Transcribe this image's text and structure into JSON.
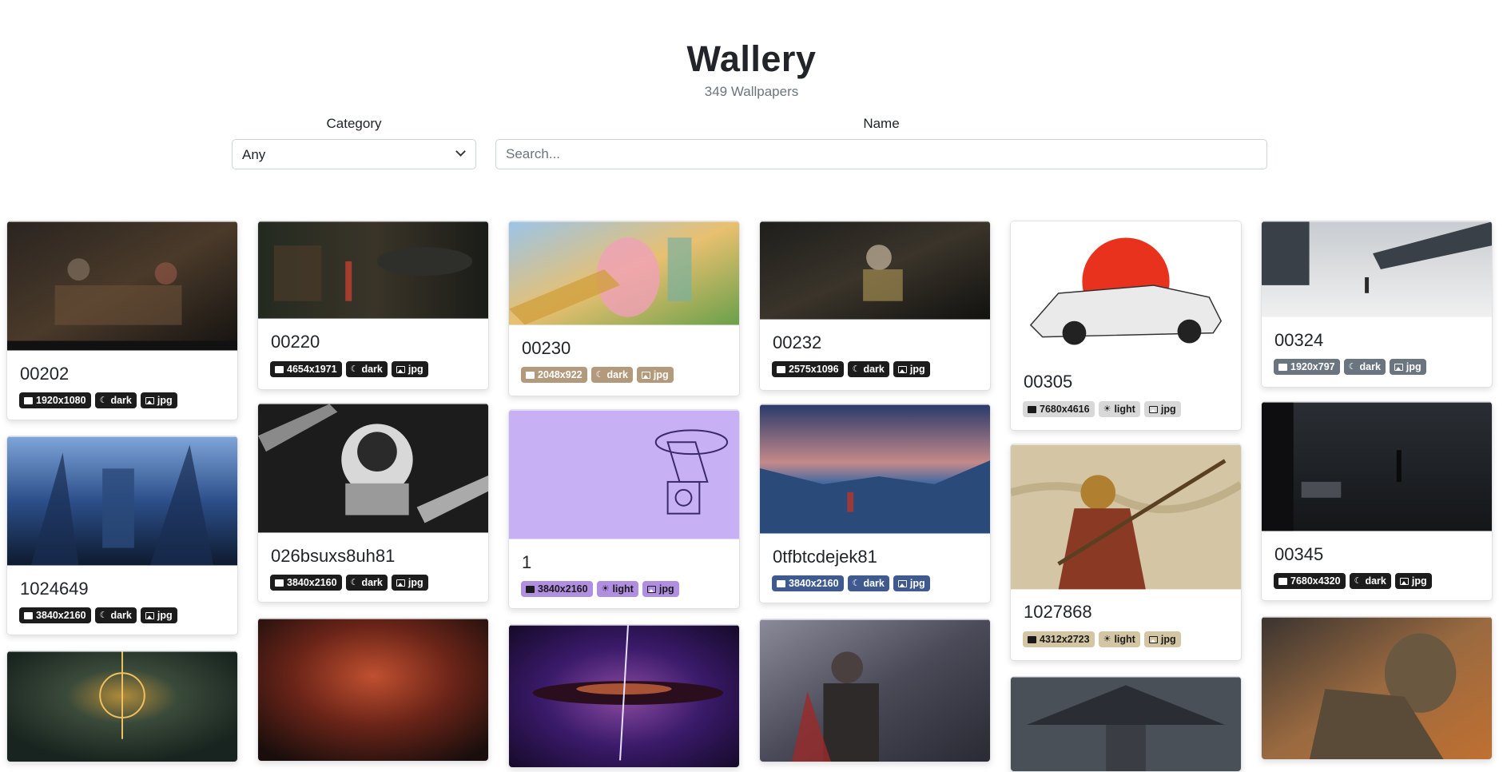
{
  "app": {
    "title": "Wallery",
    "subtitle": "349 Wallpapers"
  },
  "filters": {
    "category_label": "Category",
    "category_value": "Any",
    "name_label": "Name",
    "search_placeholder": "Search..."
  },
  "cards": [
    {
      "name": "00202",
      "resolution": "1920x1080",
      "theme": "dark",
      "format": "jpg",
      "color": "#1f1f1f"
    },
    {
      "name": "1024649",
      "resolution": "3840x2160",
      "theme": "dark",
      "format": "jpg",
      "color": "#1f2a3a"
    },
    {
      "name": "00220",
      "resolution": "4654x1971",
      "theme": "dark",
      "format": "jpg",
      "color": "#222222"
    },
    {
      "name": "026bsuxs8uh81",
      "resolution": "3840x2160",
      "theme": "dark",
      "format": "jpg",
      "color": "#1a1a1a"
    },
    {
      "name": "00230",
      "resolution": "2048x922",
      "theme": "dark",
      "format": "jpg",
      "color": "#b49a7c"
    },
    {
      "name": "1",
      "resolution": "3840x2160",
      "theme": "light",
      "format": "jpg",
      "color": "#b08ee0"
    },
    {
      "name": "00232",
      "resolution": "2575x1096",
      "theme": "dark",
      "format": "jpg",
      "color": "#1e1e1e"
    },
    {
      "name": "0tfbtcdejek81",
      "resolution": "3840x2160",
      "theme": "dark",
      "format": "jpg",
      "color": "#3f5a8f"
    },
    {
      "name": "00305",
      "resolution": "7680x4616",
      "theme": "light",
      "format": "jpg",
      "color": "#d8d8d8"
    },
    {
      "name": "1027868",
      "resolution": "4312x2723",
      "theme": "light",
      "format": "jpg",
      "color": "#d4c6a4"
    },
    {
      "name": "00324",
      "resolution": "1920x797",
      "theme": "dark",
      "format": "jpg",
      "color": "#6b7580"
    },
    {
      "name": "00345",
      "resolution": "7680x4320",
      "theme": "dark",
      "format": "jpg",
      "color": "#1b1b1b"
    }
  ]
}
